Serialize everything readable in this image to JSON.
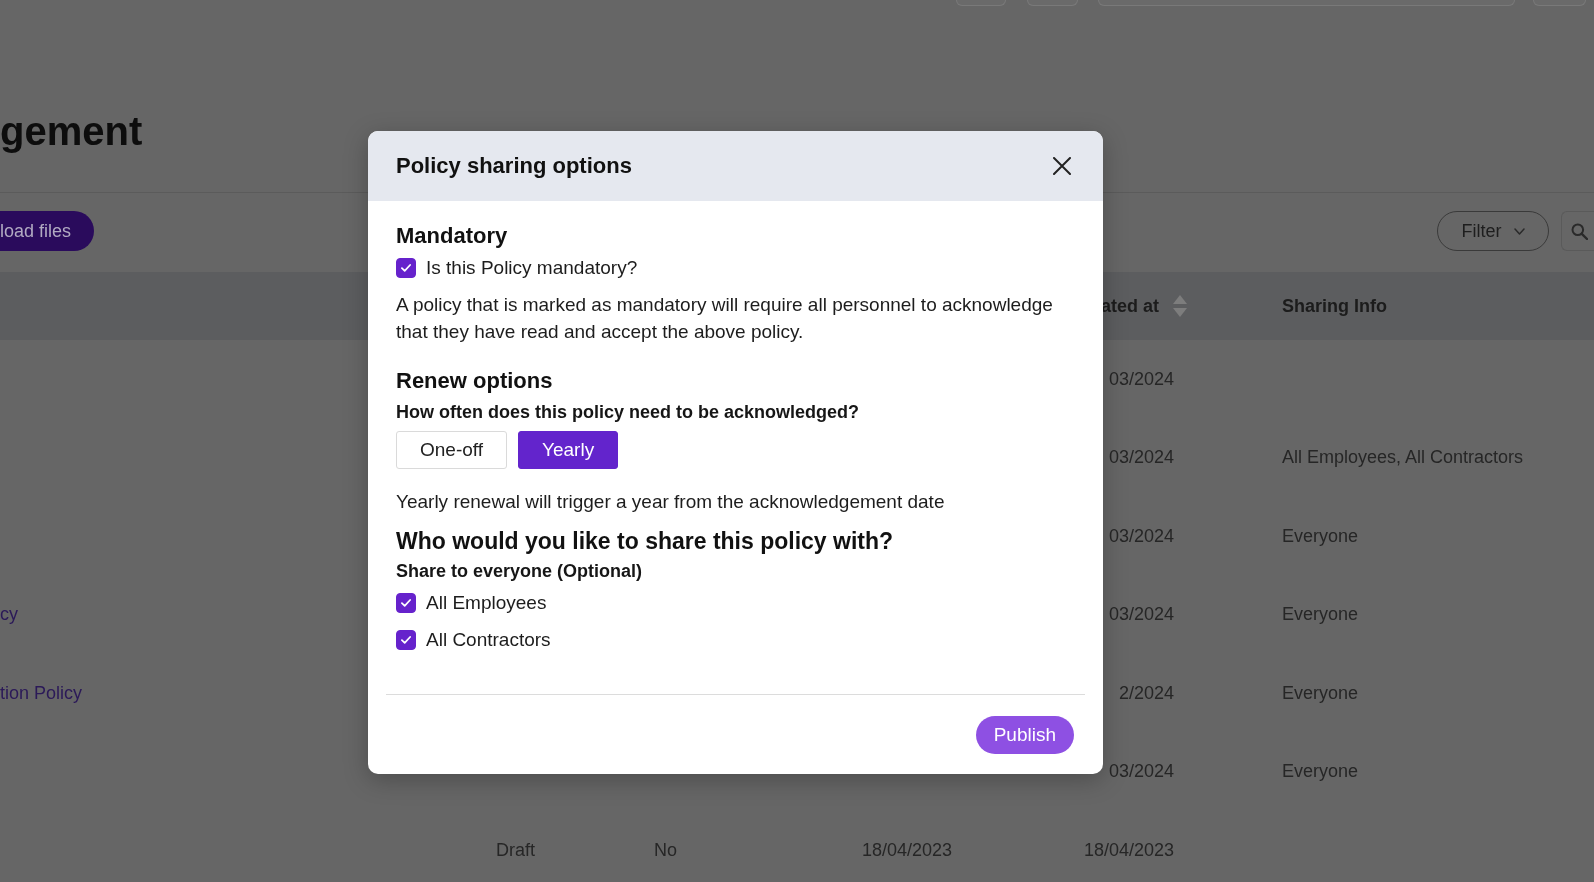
{
  "page": {
    "title": "gement",
    "upload_button": "load files",
    "filter_button": "Filter"
  },
  "table": {
    "columns": [
      {
        "label": "ated at",
        "sortable": true
      },
      {
        "label": "Sharing Info",
        "sortable": false
      }
    ],
    "rows": [
      {
        "column_5": "03/2024"
      },
      {
        "column_5": "03/2024",
        "sharing_info": "All Employees, All Contractors"
      },
      {
        "column_5": "03/2024",
        "sharing_info": "Everyone"
      },
      {
        "column_1": "cy",
        "column_5": "03/2024",
        "sharing_info": "Everyone"
      },
      {
        "column_1": "tion Policy",
        "column_5": "2/2024",
        "sharing_info": "Everyone"
      },
      {
        "column_5": "03/2024",
        "sharing_info": "Everyone"
      },
      {
        "column_2": "Draft",
        "column_3": "No",
        "column_4": "18/04/2023",
        "column_5": "18/04/2023"
      }
    ]
  },
  "dialog": {
    "title": "Policy sharing options",
    "content": [
      {
        "kind": "heading",
        "text": "Mandatory"
      },
      {
        "kind": "checkbox",
        "label": "Is this Policy mandatory?",
        "checked": true
      },
      {
        "kind": "paragraph",
        "text": "A policy that is marked as mandatory will require all personnel to acknowledge that they have read and accept the above policy."
      },
      {
        "kind": "heading",
        "text": "Renew options"
      },
      {
        "kind": "question",
        "text": "How often does this policy need to be acknowledged?"
      },
      {
        "kind": "segmented",
        "options": [
          {
            "label": "One-off",
            "selected": false
          },
          {
            "label": "Yearly",
            "selected": true
          }
        ]
      },
      {
        "kind": "paragraph",
        "text": "Yearly renewal will trigger a year from the acknowledgement date"
      },
      {
        "kind": "heading_large",
        "text": "Who would you like to share this policy with?"
      },
      {
        "kind": "question",
        "text": "Share to everyone (Optional)"
      },
      {
        "kind": "checkbox",
        "label": "All Employees",
        "checked": true
      },
      {
        "kind": "checkbox",
        "label": "All Contractors",
        "checked": true
      }
    ],
    "publish_button": "Publish"
  }
}
